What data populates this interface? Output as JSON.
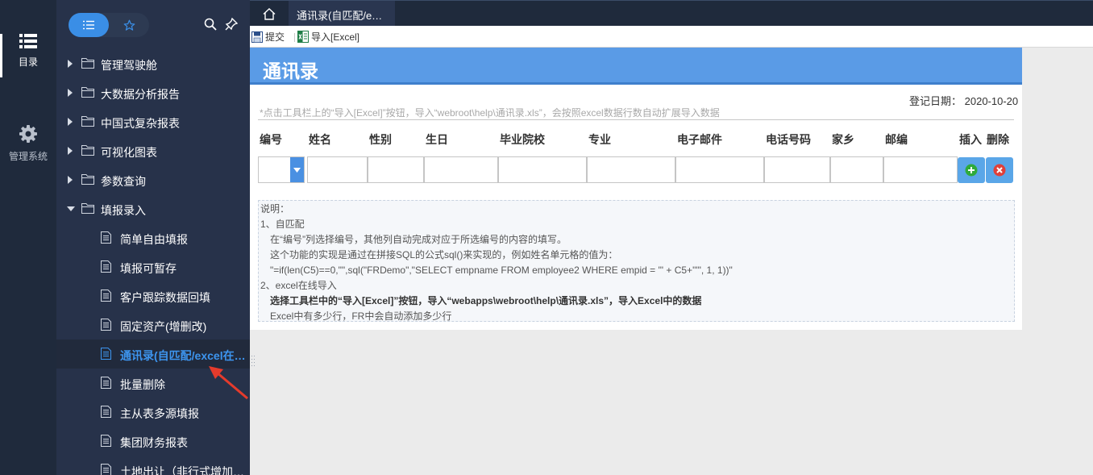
{
  "rail": {
    "catalog_label": "目录",
    "system_label": "管理系统"
  },
  "tree": [
    {
      "label": "管理驾驶舱",
      "type": "folder",
      "expanded": false
    },
    {
      "label": "大数据分析报告",
      "type": "folder",
      "expanded": false
    },
    {
      "label": "中国式复杂报表",
      "type": "folder",
      "expanded": false
    },
    {
      "label": "可视化图表",
      "type": "folder",
      "expanded": false
    },
    {
      "label": "参数查询",
      "type": "folder",
      "expanded": false
    },
    {
      "label": "填报录入",
      "type": "folder",
      "expanded": true
    },
    {
      "label": "简单自由填报",
      "type": "leaf"
    },
    {
      "label": "填报可暂存",
      "type": "leaf"
    },
    {
      "label": "客户跟踪数据回填",
      "type": "leaf"
    },
    {
      "label": "固定资产(增删改)",
      "type": "leaf"
    },
    {
      "label": "通讯录(自匹配/excel在线导入)",
      "type": "leaf",
      "selected": true
    },
    {
      "label": "批量删除",
      "type": "leaf"
    },
    {
      "label": "主从表多源填报",
      "type": "leaf"
    },
    {
      "label": "集团财务报表",
      "type": "leaf"
    },
    {
      "label": "土地出让（非行式增加行）",
      "type": "leaf"
    }
  ],
  "tab": {
    "title": "通讯录(自匹配/excel在线导入)"
  },
  "toolbar": {
    "submit_label": "提交",
    "import_label": "导入[Excel]"
  },
  "sheet": {
    "title": "通讯录",
    "date_label": "登记日期：",
    "date_value": "2020-10-20",
    "hint": "*点击工具栏上的“导入[Excel]”按钮，导入“webroot\\help\\通讯录.xls”，会按照excel数据行数自动扩展导入数据",
    "columns": [
      "编号",
      "姓名",
      "性别",
      "生日",
      "毕业院校",
      "专业",
      "电子邮件",
      "电话号码",
      "家乡",
      "邮编",
      "插入",
      "删除"
    ]
  },
  "notes": [
    "说明：",
    "1、自匹配",
    "   在“编号”列选择编号，其他列自动完成对应于所选编号的内容的填写。",
    "   这个功能的实现是通过在拼接SQL的公式sql()来实现的，例如姓名单元格的值为：",
    "    \"=if(len(C5)==0,\"\",sql(\"FRDemo\",\"SELECT empname FROM employee2 WHERE empid = '\" + C5+\"'\", 1, 1))\"",
    "2、excel在线导入",
    "   选择工具栏中的“导入[Excel]”按钮，导入“webapps\\webroot\\help\\通讯录.xls”，导入Excel中的数据",
    "   Excel中有多少行，FR中会自动添加多少行"
  ],
  "colors": {
    "rail_bg": "#1f2a3c",
    "panel_bg": "#27324a",
    "accent": "#3a8ee6",
    "title_bar": "#5a9be6",
    "selected_text": "#3d95ef"
  }
}
